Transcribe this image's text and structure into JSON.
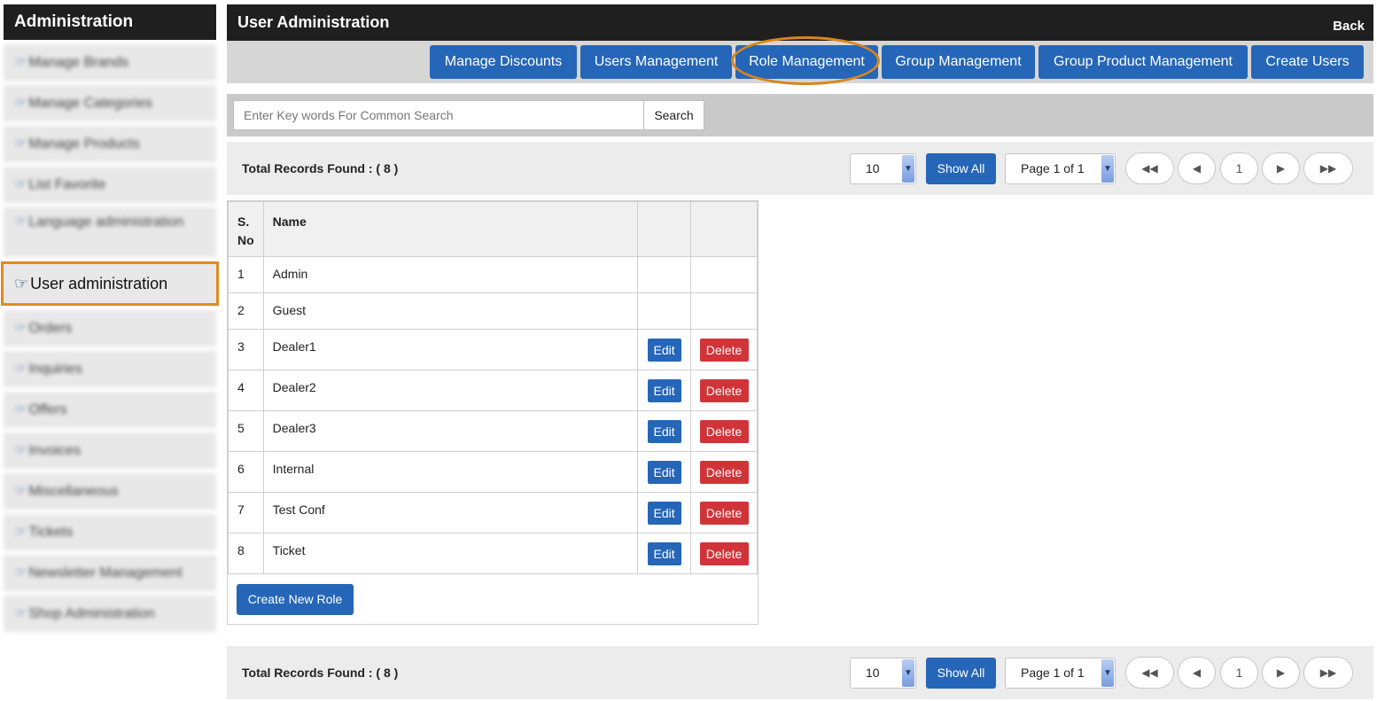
{
  "sidebar": {
    "title": "Administration",
    "items": [
      {
        "label": "Manage Brands"
      },
      {
        "label": "Manage Categories"
      },
      {
        "label": "Manage Products"
      },
      {
        "label": "List Favorite"
      },
      {
        "label": "Language administration"
      },
      {
        "label": "User administration"
      },
      {
        "label": "Orders"
      },
      {
        "label": "Inquiries"
      },
      {
        "label": "Offers"
      },
      {
        "label": "Invoices"
      },
      {
        "label": "Miscellaneous"
      },
      {
        "label": "Tickets"
      },
      {
        "label": "Newsletter Management"
      },
      {
        "label": "Shop Administration"
      }
    ]
  },
  "header": {
    "title": "User Administration",
    "back": "Back"
  },
  "tabs": [
    {
      "label": "Manage Discounts"
    },
    {
      "label": "Users Management"
    },
    {
      "label": "Role Management"
    },
    {
      "label": "Group Management"
    },
    {
      "label": "Group Product Management"
    },
    {
      "label": "Create Users"
    }
  ],
  "search": {
    "placeholder": "Enter Key words For Common Search",
    "button": "Search"
  },
  "pager": {
    "records": "Total Records Found : ( 8 )",
    "page_size": "10",
    "show_all": "Show All",
    "page_select": "Page 1 of 1",
    "first": "◀◀",
    "prev": "◀",
    "current": "1",
    "next": "▶",
    "last": "▶▶"
  },
  "table": {
    "headers": {
      "sno": "S. No",
      "name": "Name"
    },
    "rows": [
      {
        "sno": "1",
        "name": "Admin"
      },
      {
        "sno": "2",
        "name": "Guest"
      },
      {
        "sno": "3",
        "name": "Dealer1"
      },
      {
        "sno": "4",
        "name": "Dealer2"
      },
      {
        "sno": "5",
        "name": "Dealer3"
      },
      {
        "sno": "6",
        "name": "Internal"
      },
      {
        "sno": "7",
        "name": "Test Conf"
      },
      {
        "sno": "8",
        "name": "Ticket"
      }
    ],
    "edit_label": "Edit",
    "delete_label": "Delete",
    "create_role": "Create New Role"
  },
  "icons": {
    "pointing_hand": "☞",
    "caret_down": "▼"
  },
  "colors": {
    "primary": "#2566b8",
    "danger": "#d13438",
    "highlight": "#e08a1e",
    "header_bg": "#1f1f1f"
  }
}
